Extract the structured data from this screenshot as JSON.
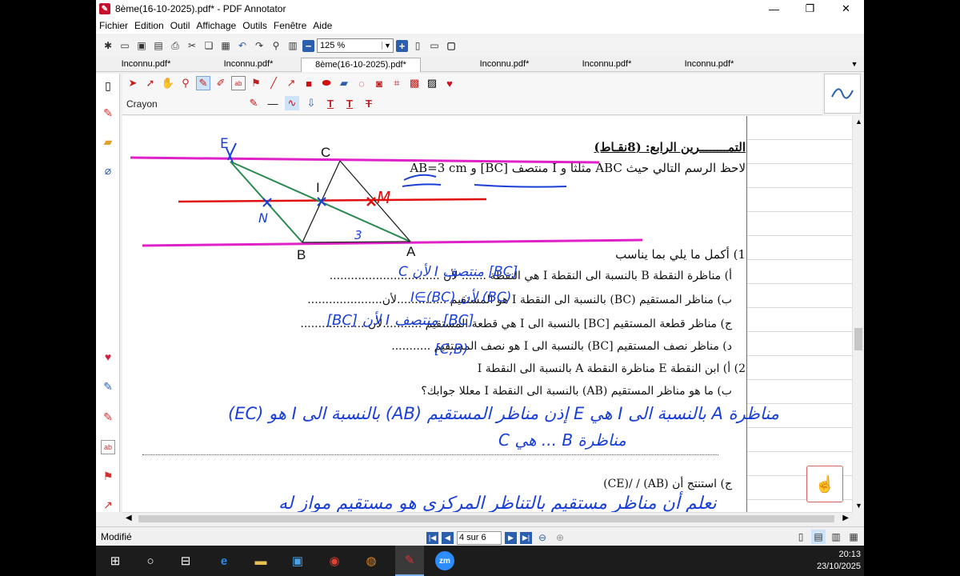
{
  "window": {
    "title": "8ème(16-10-2025).pdf* - PDF Annotator",
    "controls": [
      "—",
      "❐",
      "✕"
    ]
  },
  "menu": [
    "Fichier",
    "Edition",
    "Outil",
    "Affichage",
    "Outils",
    "Fenêtre",
    "Aide"
  ],
  "toolbar": {
    "zoom": "125 %"
  },
  "tabs": [
    "Inconnu.pdf*",
    "Inconnu.pdf*",
    "8ème(16-10-2025).pdf*",
    "Inconnu.pdf*",
    "Inconnu.pdf*",
    "Inconnu.pdf*"
  ],
  "active_tab": 2,
  "annot": {
    "tool_label": "Crayon"
  },
  "document": {
    "exercise_title": "التمــــــــرين الرابع: (8نقـاط)",
    "instruction": "لاحظ الرسم التالي حيث ABC مثلثا و I منتصف [BC] و AB=3 cm",
    "q1": "1) أكمل ما يلي بما يناسب",
    "q1a": "أ)   مناظرة النقطة B بالنسبة الى النقطة I هي النقطة ....... لأن ...............................",
    "q1b": "ب) مناظر المستقيم (BC) بالنسبة الى النقطة I هو المستقيم ..............لأن.....................",
    "q1c": "ج)  مناظر قطعة المستقيم [BC] بالنسبة الى I هي قطعة المستقيم ...........لأن ..................",
    "q1d": "د)   مناظر نصف المستقيم [BC) بالنسبة الى I هو نصف المستقيم ...........",
    "q2a": "2) أ) ابن النقطة E مناظرة النقطة A بالنسبة الى النقطة I",
    "q2b": "ب) ما هو مناظر المستقيم (AB) بالنسبة الى النقطة I معللا جوابك؟",
    "q2c": "ج)   استنتج أن (AB) / /(CE)",
    "labels": {
      "E": "E",
      "C": "C",
      "I": "I",
      "M": "M",
      "N": "N",
      "B": "B",
      "A": "A",
      "three": "3"
    },
    "handwriting": {
      "h1": "[BC] منتصف I لأن C",
      "h2": "I∈(BC) لأن (BC)",
      "h3": "[BC] منتصف I لأن [BC]",
      "h4": "[C,B)",
      "h5": "مناظرة A بالنسبة الى I هي E إذن مناظر المستقيم (AB) بالنسبة الى I هو (EC)",
      "h6": "مناظرة B ... هي C",
      "h7": "نعلم أن مناظر مستقيم بالتناظر المركزي هو مستقيم موازٍ له"
    }
  },
  "status": {
    "state": "Modifié",
    "page": "4 sur 6"
  },
  "taskbar": {
    "time": "20:13",
    "date": "23/10/2025"
  },
  "colors": {
    "pen_blue": "#1a3fd6",
    "magenta": "#e020c8",
    "red": "#e01010",
    "green": "#2a8a50",
    "margin_red": "#e23a3a"
  }
}
